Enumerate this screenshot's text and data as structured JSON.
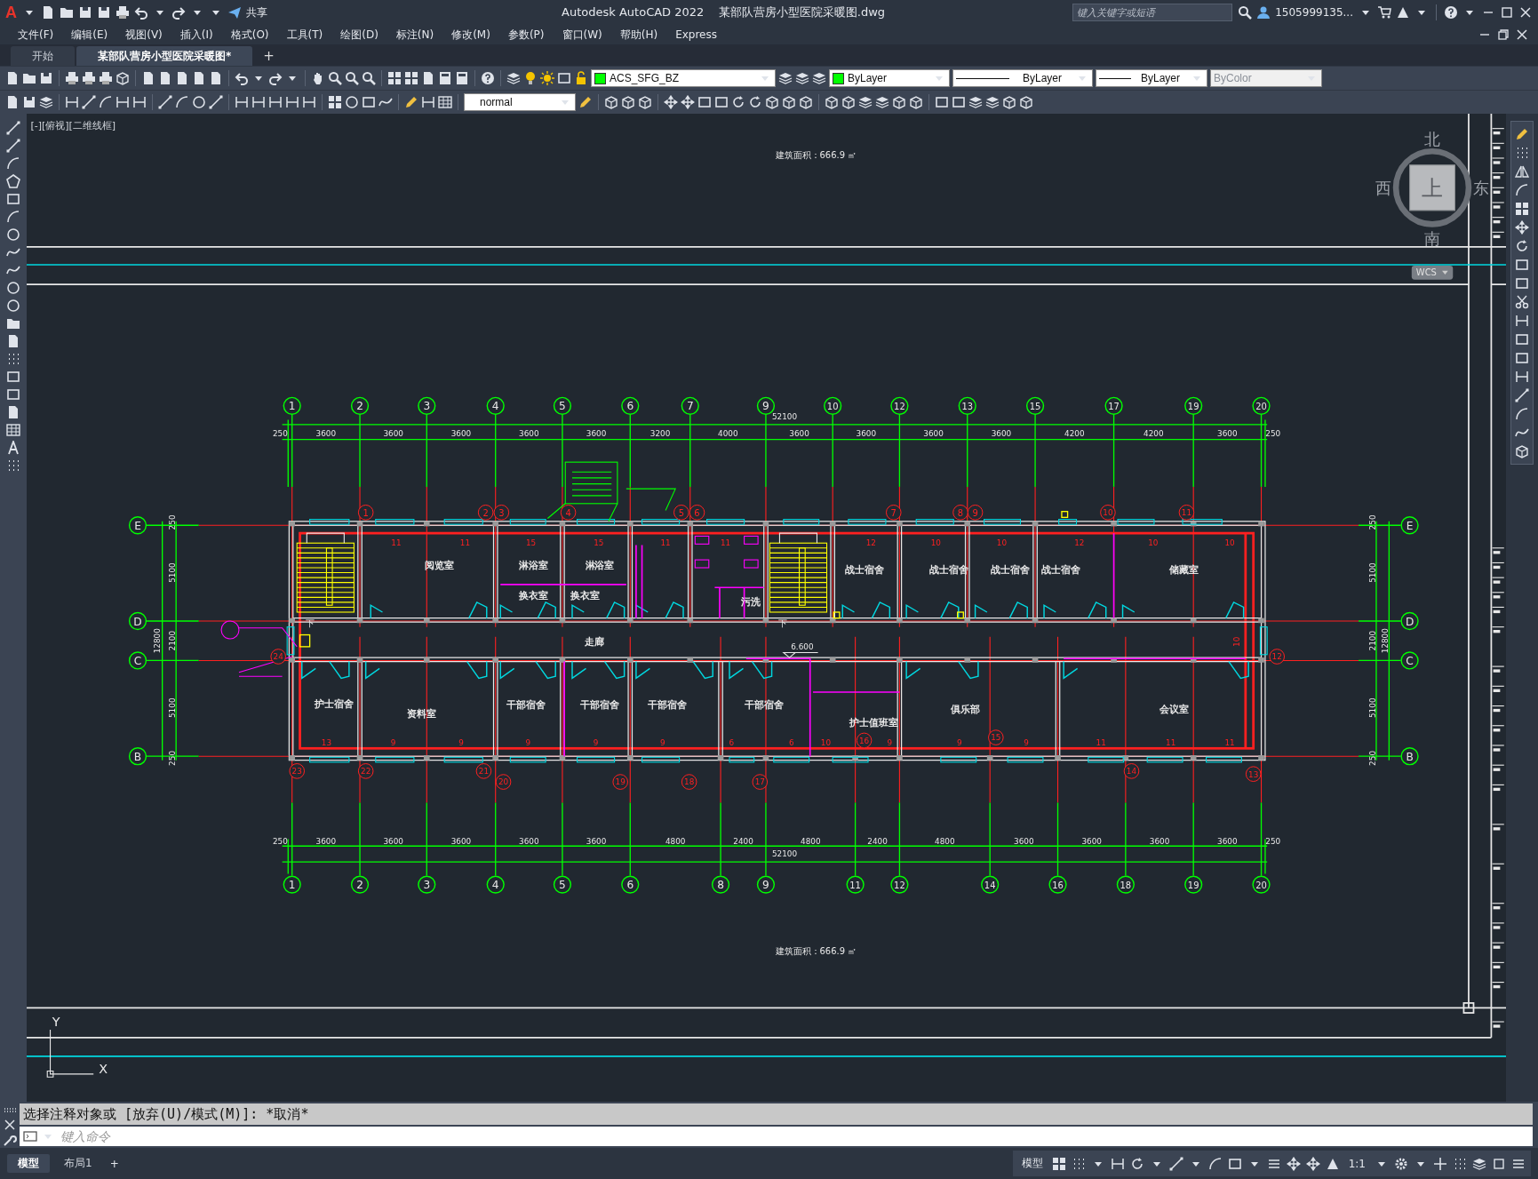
{
  "title_bar": {
    "logo": "A",
    "share": "共享",
    "title": "Autodesk AutoCAD 2022    某部队营房小型医院采暖图.dwg",
    "search": {
      "placeholder": "键入关键字或短语"
    },
    "user": "1505999135..."
  },
  "menu": [
    "文件(F)",
    "编辑(E)",
    "视图(V)",
    "插入(I)",
    "格式(O)",
    "工具(T)",
    "绘图(D)",
    "标注(N)",
    "修改(M)",
    "参数(P)",
    "窗口(W)",
    "帮助(H)",
    "Express"
  ],
  "doc_tabs": [
    {
      "label": "开始",
      "selected": false
    },
    {
      "label": "某部队营房小型医院采暖图*",
      "selected": true
    }
  ],
  "new_tab": "+",
  "toolbar": {
    "layer": "ACS_SFG_BZ",
    "color_setting": "ByLayer",
    "linetype": "ByLayer",
    "lineweight": "ByLayer",
    "plot_style": {
      "value": "ByColor",
      "disabled": true
    },
    "text_style": "normal"
  },
  "viewport": {
    "label": "[-][俯视][二维线框]"
  },
  "viewcube": {
    "north": "北",
    "south": "南",
    "west": "西",
    "east": "东",
    "face": "上",
    "ucs": "WCS"
  },
  "ucs_icon": {
    "y": "Y",
    "x": "X"
  },
  "drawing": {
    "area_labels": [
      "建筑面积：666.9 ㎡",
      "建筑面积：666.9 ㎡"
    ],
    "top_axes": [
      "1",
      "2",
      "3",
      "4",
      "5",
      "6",
      "7",
      "9",
      "10",
      "12",
      "13",
      "15",
      "17",
      "19",
      "20"
    ],
    "top_total": "52100",
    "top_dims": [
      "250",
      "3600",
      "3600",
      "3600",
      "3600",
      "3600",
      "3200",
      "4000",
      "3600",
      "3600",
      "3600",
      "3600",
      "4200",
      "4200",
      "3600",
      "250"
    ],
    "bottom_dims": [
      "250",
      "3600",
      "3600",
      "3600",
      "3600",
      "3600",
      "4800",
      "2400",
      "4800",
      "2400",
      "4800",
      "3600",
      "3600",
      "3600",
      "3600",
      "250"
    ],
    "bottom_total": "52100",
    "bottom_axes": [
      "1",
      "2",
      "3",
      "4",
      "5",
      "6",
      "8",
      "9",
      "11",
      "12",
      "14",
      "16",
      "18",
      "19",
      "20"
    ],
    "left_axes": [
      "E",
      "D",
      "C",
      "B"
    ],
    "left_dims": [
      "250",
      "5100",
      "2100",
      "5100",
      "250"
    ],
    "left_total": "12800",
    "right_axes": [
      "E",
      "D",
      "C",
      "B"
    ],
    "right_dims": [
      "250",
      "5100",
      "2100",
      "5100",
      "250"
    ],
    "right_total": "12800",
    "rooms": [
      "阅览室",
      "淋浴室",
      "淋浴室",
      "换衣室",
      "换衣室",
      "污洗",
      "战士宿舍",
      "战士宿舍",
      "战士宿舍",
      "战士宿舍",
      "储藏室",
      "走廊",
      "护士宿舍",
      "资料室",
      "干部宿舍",
      "干部宿舍",
      "干部宿舍",
      "干部宿舍",
      "护士值班室",
      "俱乐部",
      "会议室"
    ],
    "stair_marks": [
      "下",
      "下"
    ],
    "elevation": "6.600",
    "heater_counts": [
      "11",
      "11",
      "15",
      "15",
      "11",
      "11",
      "12",
      "10",
      "10",
      "12",
      "10",
      "10",
      "13",
      "9",
      "9",
      "9",
      "9",
      "9",
      "6",
      "6",
      "10",
      "9",
      "9",
      "9",
      "11",
      "11",
      "11",
      "10"
    ],
    "riser_markers": [
      "1",
      "2",
      "3",
      "4",
      "5",
      "6",
      "7",
      "8",
      "9",
      "10",
      "11",
      "24",
      "12",
      "23",
      "22",
      "21",
      "20",
      "19",
      "18",
      "17",
      "16",
      "15",
      "14",
      "13"
    ]
  },
  "command": {
    "history": "选择注释对象或 [放弃(U)/模式(M)]: *取消*",
    "placeholder": "键入命令"
  },
  "layout_tabs": [
    {
      "label": "模型",
      "selected": true
    },
    {
      "label": "布局1",
      "selected": false
    }
  ],
  "add_layout": "+",
  "status": {
    "space": "模型",
    "scale": "1:1"
  }
}
